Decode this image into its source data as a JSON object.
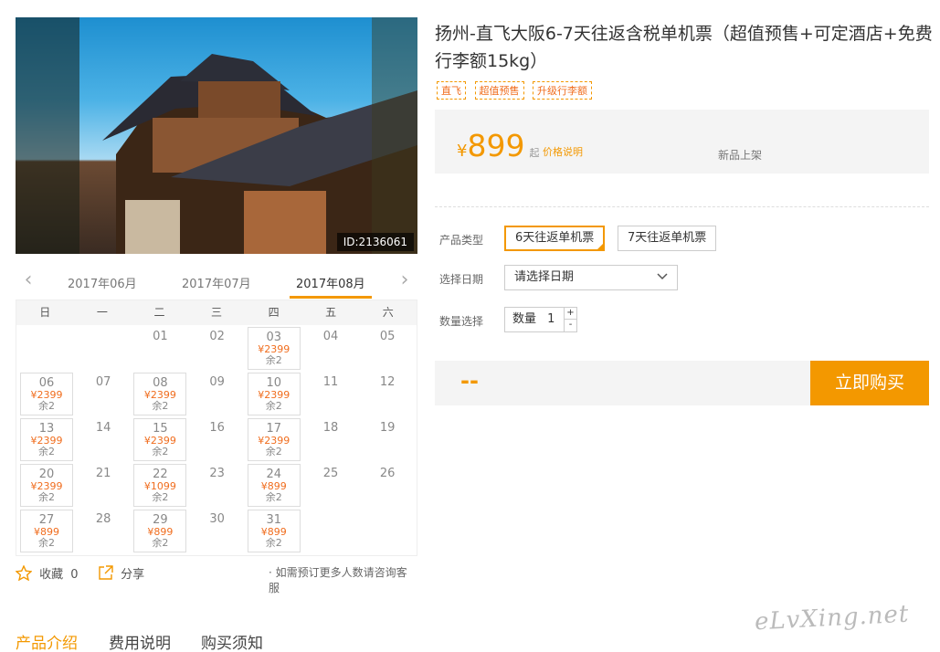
{
  "hero": {
    "id_badge": "ID:2136061"
  },
  "calendar": {
    "prev_icon": "chevron-left-icon",
    "next_icon": "chevron-right-icon",
    "months": [
      "2017年06月",
      "2017年07月",
      "2017年08月"
    ],
    "active_month": "2017年08月",
    "weekdays": [
      "日",
      "一",
      "二",
      "三",
      "四",
      "五",
      "六"
    ],
    "days": [
      {
        "d": "01"
      },
      {
        "d": "02"
      },
      {
        "d": "03",
        "price": "¥2399",
        "remain": "余2"
      },
      {
        "d": "04"
      },
      {
        "d": "05"
      },
      {
        "d": "06",
        "price": "¥2399",
        "remain": "余2"
      },
      {
        "d": "07"
      },
      {
        "d": "08",
        "price": "¥2399",
        "remain": "余2"
      },
      {
        "d": "09"
      },
      {
        "d": "10",
        "price": "¥2399",
        "remain": "余2"
      },
      {
        "d": "11"
      },
      {
        "d": "12"
      },
      {
        "d": "13",
        "price": "¥2399",
        "remain": "余2"
      },
      {
        "d": "14"
      },
      {
        "d": "15",
        "price": "¥2399",
        "remain": "余2"
      },
      {
        "d": "16"
      },
      {
        "d": "17",
        "price": "¥2399",
        "remain": "余2"
      },
      {
        "d": "18"
      },
      {
        "d": "19"
      },
      {
        "d": "20",
        "price": "¥2399",
        "remain": "余2"
      },
      {
        "d": "21"
      },
      {
        "d": "22",
        "price": "¥1099",
        "remain": "余2"
      },
      {
        "d": "23"
      },
      {
        "d": "24",
        "price": "¥899",
        "remain": "余2"
      },
      {
        "d": "25"
      },
      {
        "d": "26"
      },
      {
        "d": "27",
        "price": "¥899",
        "remain": "余2"
      },
      {
        "d": "28"
      },
      {
        "d": "29",
        "price": "¥899",
        "remain": "余2"
      },
      {
        "d": "30"
      },
      {
        "d": "31",
        "price": "¥899",
        "remain": "余2"
      }
    ],
    "first_weekday": 2
  },
  "actions": {
    "favorite_label": "收藏",
    "favorite_count": "0",
    "share_label": "分享",
    "note": "· 如需预订更多人数请咨询客服"
  },
  "tabs": [
    "产品介绍",
    "费用说明",
    "购买须知"
  ],
  "product": {
    "title": "扬州-直飞大阪6-7天往返含税单机票（超值预售+可定酒店+免费行李额15kg）",
    "tags": [
      "直飞",
      "超值预售",
      "升级行李额"
    ],
    "currency": "¥",
    "price": "899",
    "price_suffix": "起",
    "price_note": "价格说明",
    "new_label": "新品上架"
  },
  "options": {
    "type_label": "产品类型",
    "types": [
      "6天往返单机票",
      "7天往返单机票"
    ],
    "selected_type": "6天往返单机票",
    "date_label": "选择日期",
    "date_placeholder": "请选择日期",
    "qty_label": "数量选择",
    "qty_text": "数量",
    "qty_value": "1",
    "plus": "+",
    "minus": "-"
  },
  "buy": {
    "total": "--",
    "button": "立即购买"
  },
  "watermark": "eLvXing.net",
  "colors": {
    "accent": "#f39800",
    "price": "#f06d1e"
  }
}
